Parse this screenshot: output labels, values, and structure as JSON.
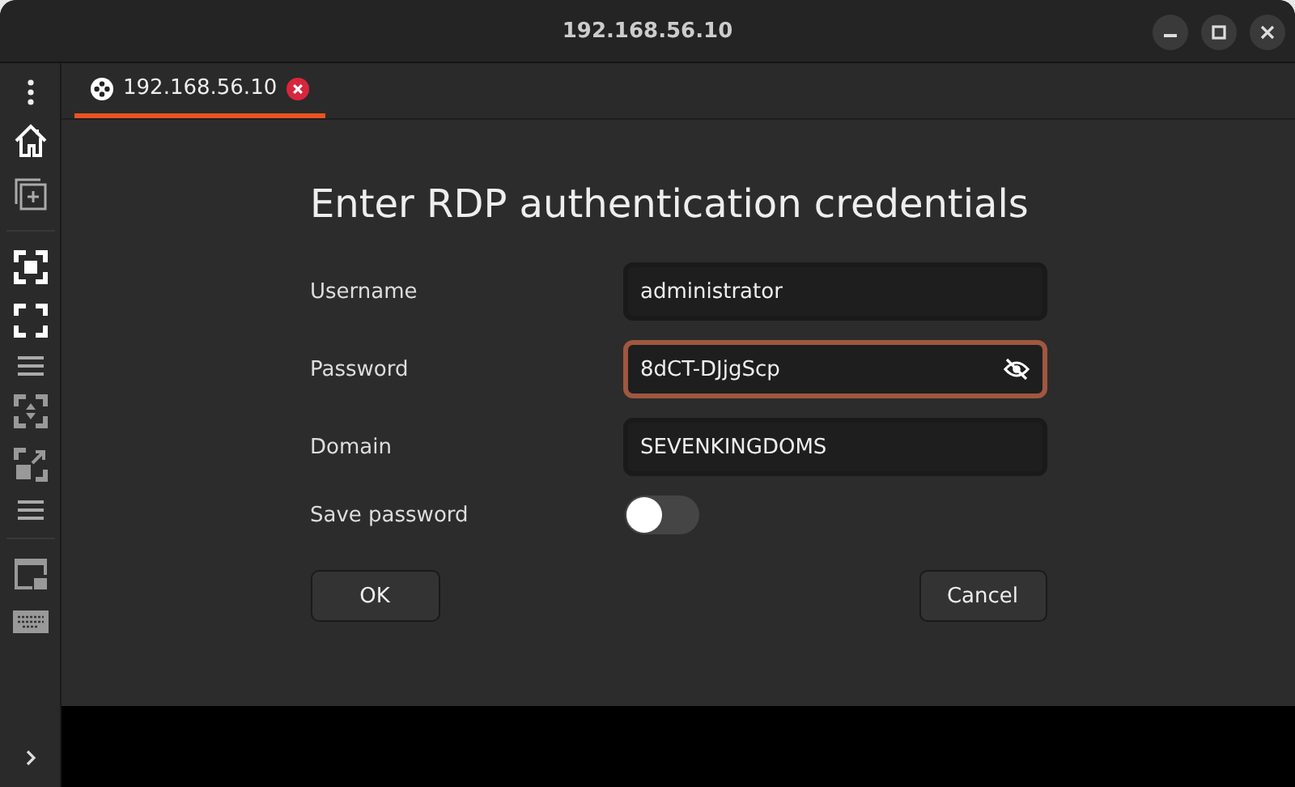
{
  "window": {
    "title": "192.168.56.10"
  },
  "tabs": [
    {
      "label": "192.168.56.10",
      "selected": true
    }
  ],
  "dialog": {
    "title": "Enter RDP authentication credentials",
    "fields": [
      {
        "label": "Username",
        "value": "administrator",
        "kind": "text",
        "focused": false
      },
      {
        "label": "Password",
        "value": "8dCT-DJjgScp",
        "kind": "password",
        "focused": true
      },
      {
        "label": "Domain",
        "value": "SEVENKINGDOMS",
        "kind": "text",
        "focused": false
      }
    ],
    "toggle": {
      "label": "Save password",
      "on": false
    },
    "buttons": [
      "OK",
      "Cancel"
    ]
  }
}
